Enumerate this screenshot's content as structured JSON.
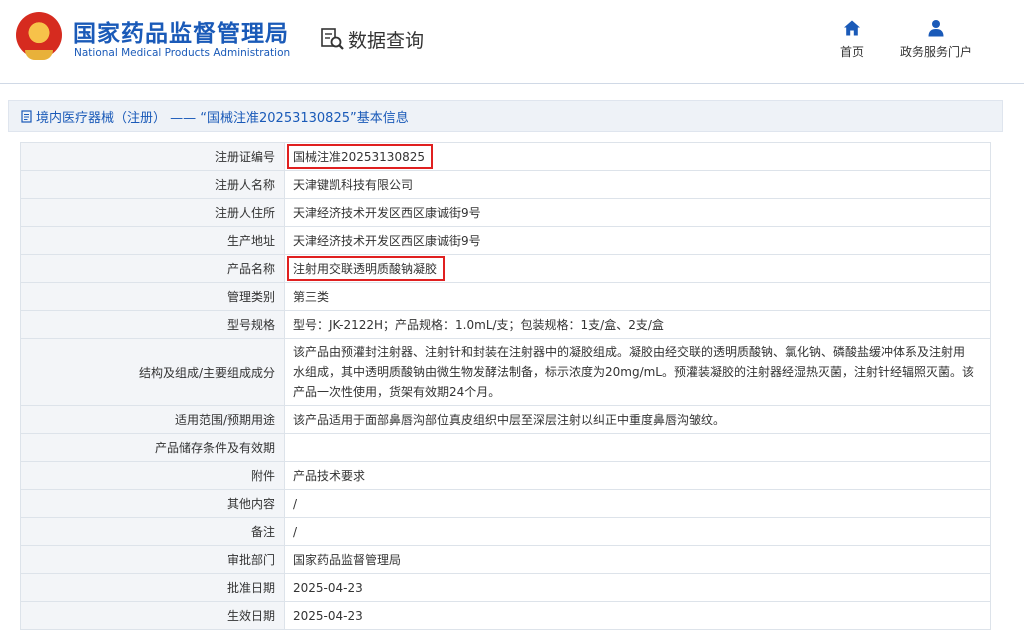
{
  "header": {
    "brand_cn": "国家药品监督管理局",
    "brand_en": "National Medical Products Administration",
    "query_label": "数据查询",
    "nav": [
      {
        "label": "首页",
        "icon": "home-icon"
      },
      {
        "label": "政务服务门户",
        "icon": "user-icon"
      }
    ]
  },
  "titlebar": {
    "text": "境内医疗器械（注册） —— “国械注准20253130825”基本信息"
  },
  "rows": [
    {
      "key": "注册证编号",
      "value": "国械注准20253130825",
      "highlight": true
    },
    {
      "key": "注册人名称",
      "value": "天津键凯科技有限公司"
    },
    {
      "key": "注册人住所",
      "value": "天津经济技术开发区西区康诚街9号"
    },
    {
      "key": "生产地址",
      "value": "天津经济技术开发区西区康诚街9号"
    },
    {
      "key": "产品名称",
      "value": "注射用交联透明质酸钠凝胶",
      "highlight": true
    },
    {
      "key": "管理类别",
      "value": "第三类"
    },
    {
      "key": "型号规格",
      "value": "型号：JK-2122H；产品规格：1.0mL/支；包装规格：1支/盒、2支/盒"
    },
    {
      "key": "结构及组成/主要组成成分",
      "value": "该产品由预灌封注射器、注射针和封装在注射器中的凝胶组成。凝胶由经交联的透明质酸钠、氯化钠、磷酸盐缓冲体系及注射用水组成，其中透明质酸钠由微生物发酵法制备，标示浓度为20mg/mL。预灌装凝胶的注射器经湿热灭菌，注射针经辐照灭菌。该产品一次性使用，货架有效期24个月。"
    },
    {
      "key": "适用范围/预期用途",
      "value": "该产品适用于面部鼻唇沟部位真皮组织中层至深层注射以纠正中重度鼻唇沟皱纹。"
    },
    {
      "key": "产品储存条件及有效期",
      "value": ""
    },
    {
      "key": "附件",
      "value": "产品技术要求"
    },
    {
      "key": "其他内容",
      "value": "/"
    },
    {
      "key": "备注",
      "value": "/"
    },
    {
      "key": "审批部门",
      "value": "国家药品监督管理局"
    },
    {
      "key": "批准日期",
      "value": "2025-04-23"
    },
    {
      "key": "生效日期",
      "value": "2025-04-23"
    }
  ],
  "colors": {
    "brand_blue": "#1a5ab8",
    "highlight_red": "#e02020",
    "key_cell_bg": "#f3f5f8",
    "border": "#dde3ea"
  }
}
